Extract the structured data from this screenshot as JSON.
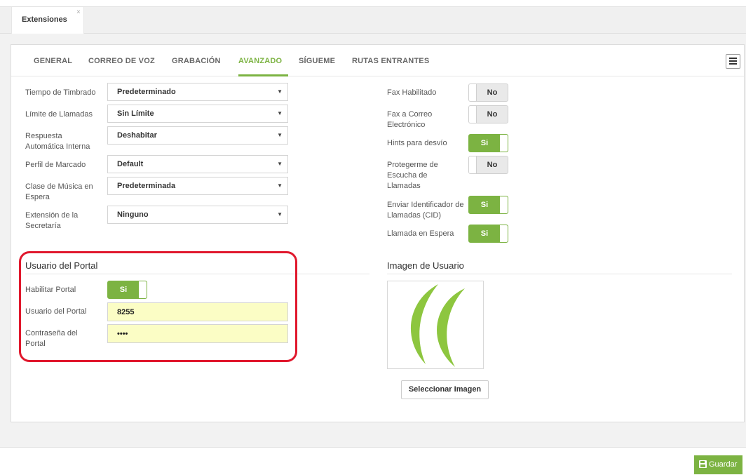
{
  "window": {
    "tab_label": "Extensiones",
    "close_glyph": "×"
  },
  "tabs": [
    {
      "label": "GENERAL"
    },
    {
      "label": "CORREO DE VOZ"
    },
    {
      "label": "GRABACIÓN"
    },
    {
      "label": "AVANZADO",
      "active": true
    },
    {
      "label": "SÍGUEME"
    },
    {
      "label": "RUTAS ENTRANTES"
    }
  ],
  "icons": {
    "menu": "list-icon",
    "dropdown": "caret-down-icon",
    "save": "floppy-disk-icon",
    "user_image": "green-c-logo"
  },
  "colors": {
    "accent": "#7cb342",
    "highlight": "#e0182d",
    "input_fill": "#fbfdc5"
  },
  "left_fields": [
    {
      "label": "Tiempo de Timbrado",
      "value": "Predeterminado"
    },
    {
      "label": "Límite de Llamadas",
      "value": "Sin Límite"
    },
    {
      "label": "Respuesta Automática Interna",
      "value": "Deshabitar"
    },
    {
      "label": "Perfil de Marcado",
      "value": "Default"
    },
    {
      "label": "Clase de Música en Espera",
      "value": "Predeterminada"
    },
    {
      "label": "Extensión de la Secretaría",
      "value": "Ninguno"
    }
  ],
  "dropdown_arrow": "▼",
  "right_toggles": [
    {
      "label": "Fax Habilitado",
      "state": "No"
    },
    {
      "label": "Fax a Correo Electrónico",
      "state": "No"
    },
    {
      "label": "Hints para desvío",
      "state": "Si"
    },
    {
      "label": "Protegerme de Escucha de Llamadas",
      "state": "No"
    },
    {
      "label": "Enviar Identificador de Llamadas (CID)",
      "state": "Si"
    },
    {
      "label": "Llamada en Espera",
      "state": "Si"
    }
  ],
  "portal": {
    "title": "Usuario del Portal",
    "enable_label": "Habilitar Portal",
    "enable_state": "Si",
    "user_label": "Usuario del Portal",
    "user_value": "8255",
    "password_label": "Contraseña del Portal",
    "password_value": "••••"
  },
  "user_image": {
    "title": "Imagen de Usuario",
    "select_button": "Seleccionar Imagen"
  },
  "footer": {
    "save_label": "Guardar"
  }
}
